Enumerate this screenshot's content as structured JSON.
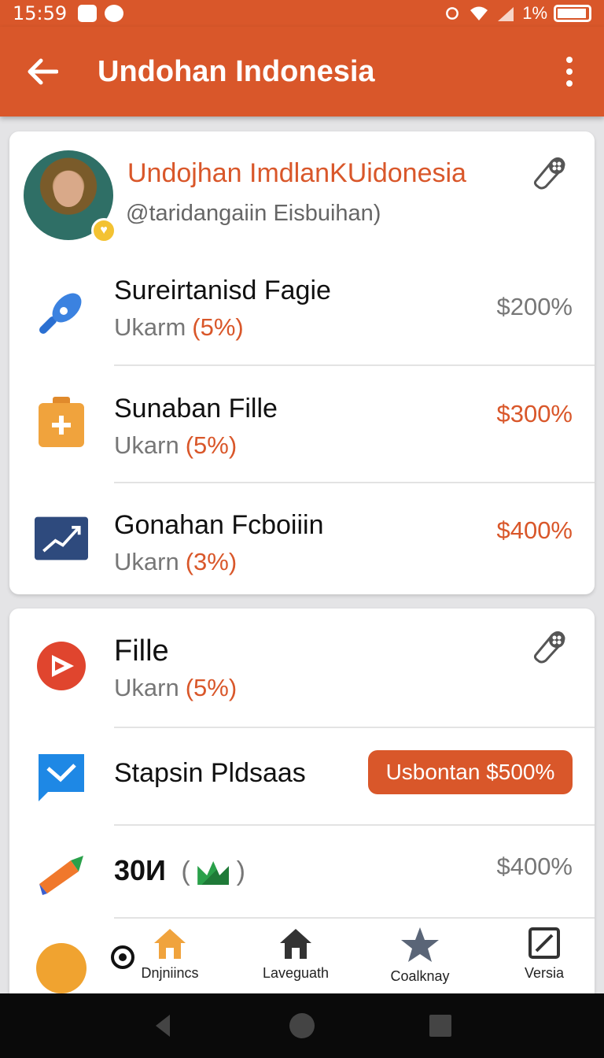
{
  "status_bar": {
    "time": "15:59",
    "battery": "1%"
  },
  "app_bar": {
    "title": "Undohan Indonesia"
  },
  "profile": {
    "name": "Undojhan ImdlanKUidonesia",
    "handle": "@taridangaiin Eisbuihan)"
  },
  "card1_items": [
    {
      "name": "Sureirtanisd Fagie",
      "sub": "Ukarm",
      "pct": "(5%)",
      "price": "$200%",
      "price_color": "gray",
      "icon": "violin-icon"
    },
    {
      "name": "Sunaban Fille",
      "sub": "Ukarn",
      "pct": "(5%)",
      "price": "$300%",
      "price_color": "orange",
      "icon": "medkit-icon"
    },
    {
      "name": "Gonahan Fcboiiin",
      "sub": "Ukarn",
      "pct": "(3%)",
      "price": "$400%",
      "price_color": "orange",
      "icon": "trend-chart-icon"
    }
  ],
  "card2_items": {
    "file": {
      "name": "Fille",
      "sub": "Ukarn",
      "pct": "(5%)"
    },
    "stapsin": {
      "name": "Stapsin Pldsaas",
      "button": "Usbontan $500%"
    },
    "number": {
      "name": "30И",
      "paren_open": "(",
      "paren_close": ")",
      "price": "$400%"
    }
  },
  "bottom_nav": [
    {
      "label": "Dnjniincs",
      "icon": "home-orange-icon"
    },
    {
      "label": "Laveguath",
      "icon": "home-dark-icon"
    },
    {
      "label": "Coalknay",
      "icon": "star-icon"
    },
    {
      "label": "Versia",
      "icon": "edit-icon"
    }
  ],
  "colors": {
    "accent": "#d9572a",
    "background": "#e4e4e6"
  }
}
